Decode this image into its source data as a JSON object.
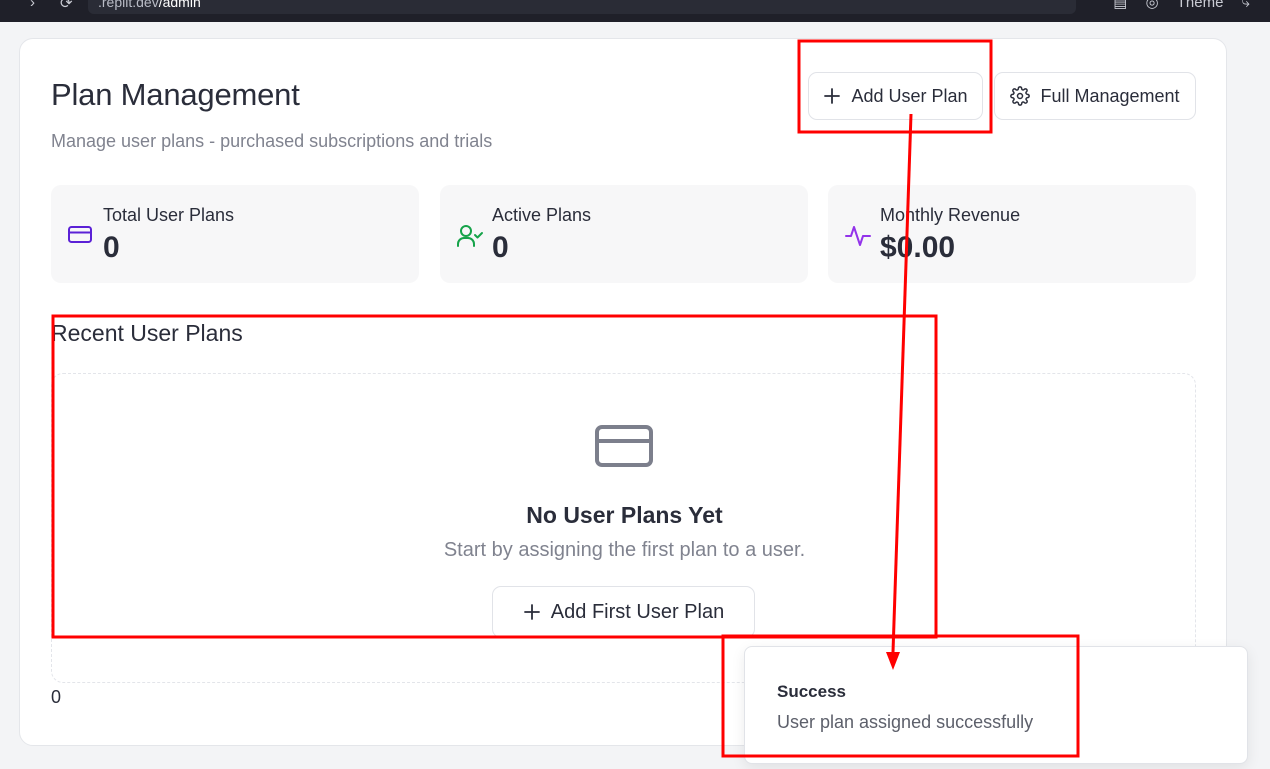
{
  "browser": {
    "url_prefix": ".replit.dev",
    "url_path": "/admin",
    "theme_label": "Theme"
  },
  "header": {
    "title": "Plan Management",
    "subtitle": "Manage user plans - purchased subscriptions and trials",
    "add_button_label": "Add User Plan",
    "full_button_label": "Full Management"
  },
  "stats": [
    {
      "label": "Total User Plans",
      "value": "0",
      "icon": "credit-card-icon",
      "color": "#5b21d6"
    },
    {
      "label": "Active Plans",
      "value": "0",
      "icon": "user-check-icon",
      "color": "#16a34a"
    },
    {
      "label": "Monthly Revenue",
      "value": "$0.00",
      "icon": "activity-icon",
      "color": "#9333ea"
    }
  ],
  "recent": {
    "title": "Recent User Plans",
    "empty_title": "No User Plans Yet",
    "empty_desc": "Start by assigning the first plan to a user.",
    "empty_button_label": "Add First User Plan",
    "count": "0"
  },
  "toast": {
    "title": "Success",
    "description": "User plan assigned successfully"
  },
  "colors": {
    "annotation": "#ff0000",
    "muted_text": "#80838f",
    "empty_icon": "#7c7f8c"
  }
}
